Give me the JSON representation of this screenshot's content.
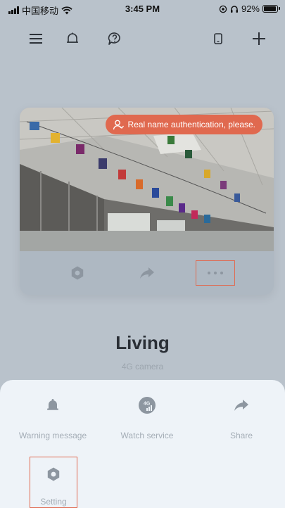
{
  "status_bar": {
    "carrier": "中国移动",
    "time": "3:45 PM",
    "battery_percent": "92%",
    "battery_level": 0.92
  },
  "toolbar": {
    "icons": [
      "menu-icon",
      "bell-icon",
      "help-chat-icon",
      "device-icon",
      "add-icon"
    ]
  },
  "camera_card": {
    "auth_notice": "Real name authentication, please.",
    "actions": [
      "settings-icon",
      "share-icon",
      "more-icon"
    ]
  },
  "device": {
    "name": "Living",
    "type": "4G camera"
  },
  "sheet": {
    "items": [
      {
        "label": "Warning message",
        "icon": "bell-icon"
      },
      {
        "label": "Watch service",
        "icon": "4g-icon"
      },
      {
        "label": "Share",
        "icon": "share-icon"
      },
      {
        "label": "Setting",
        "icon": "settings-icon"
      }
    ],
    "badge_text": "4G"
  },
  "colors": {
    "accent": "#e0694f",
    "overlay": "#b9c2cb",
    "icon_muted": "#8d96a0"
  }
}
